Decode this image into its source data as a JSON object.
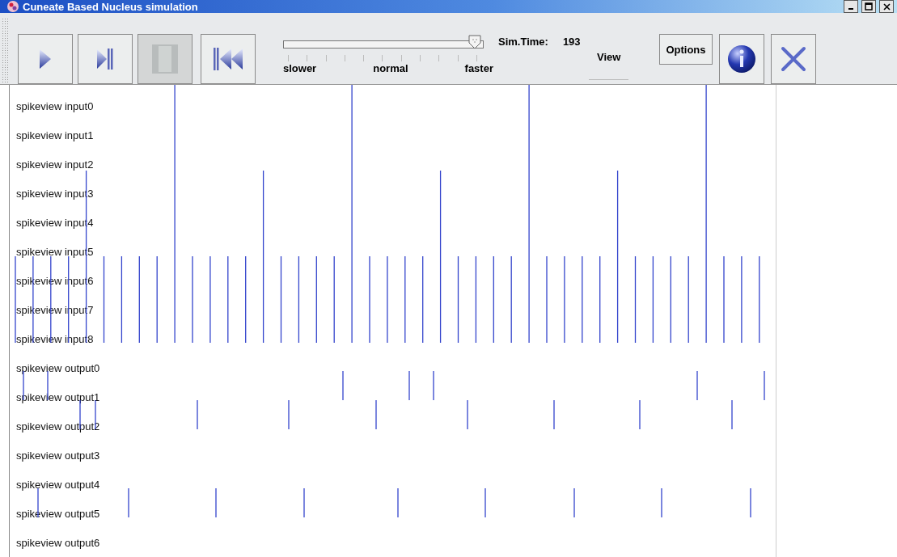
{
  "window": {
    "title": "Cuneate Based Nucleus simulation"
  },
  "toolbar": {
    "buttons": [
      {
        "kind": "play",
        "disabled": false
      },
      {
        "kind": "step",
        "disabled": false
      },
      {
        "kind": "pause",
        "disabled": true
      },
      {
        "kind": "rewind",
        "disabled": false
      }
    ],
    "speed_slider": {
      "level": 0.96,
      "labels": [
        "slower",
        "normal",
        "faster"
      ]
    },
    "sim_time": {
      "label": "Sim.Time:",
      "value": "193"
    },
    "view_label": "View",
    "options_button": "Options",
    "tool_buttons": [
      {
        "kind": "info"
      },
      {
        "kind": "close"
      }
    ]
  },
  "spike_view": {
    "rows": [
      "spikeview input0",
      "spikeview input1",
      "spikeview input2",
      "spikeview input3",
      "spikeview input4",
      "spikeview input5",
      "spikeview input6",
      "spikeview input7",
      "spikeview input8",
      "spikeview output0",
      "spikeview output1",
      "spikeview output2",
      "spikeview output3",
      "spikeview output4",
      "spikeview output5",
      "spikeview output6"
    ]
  }
}
